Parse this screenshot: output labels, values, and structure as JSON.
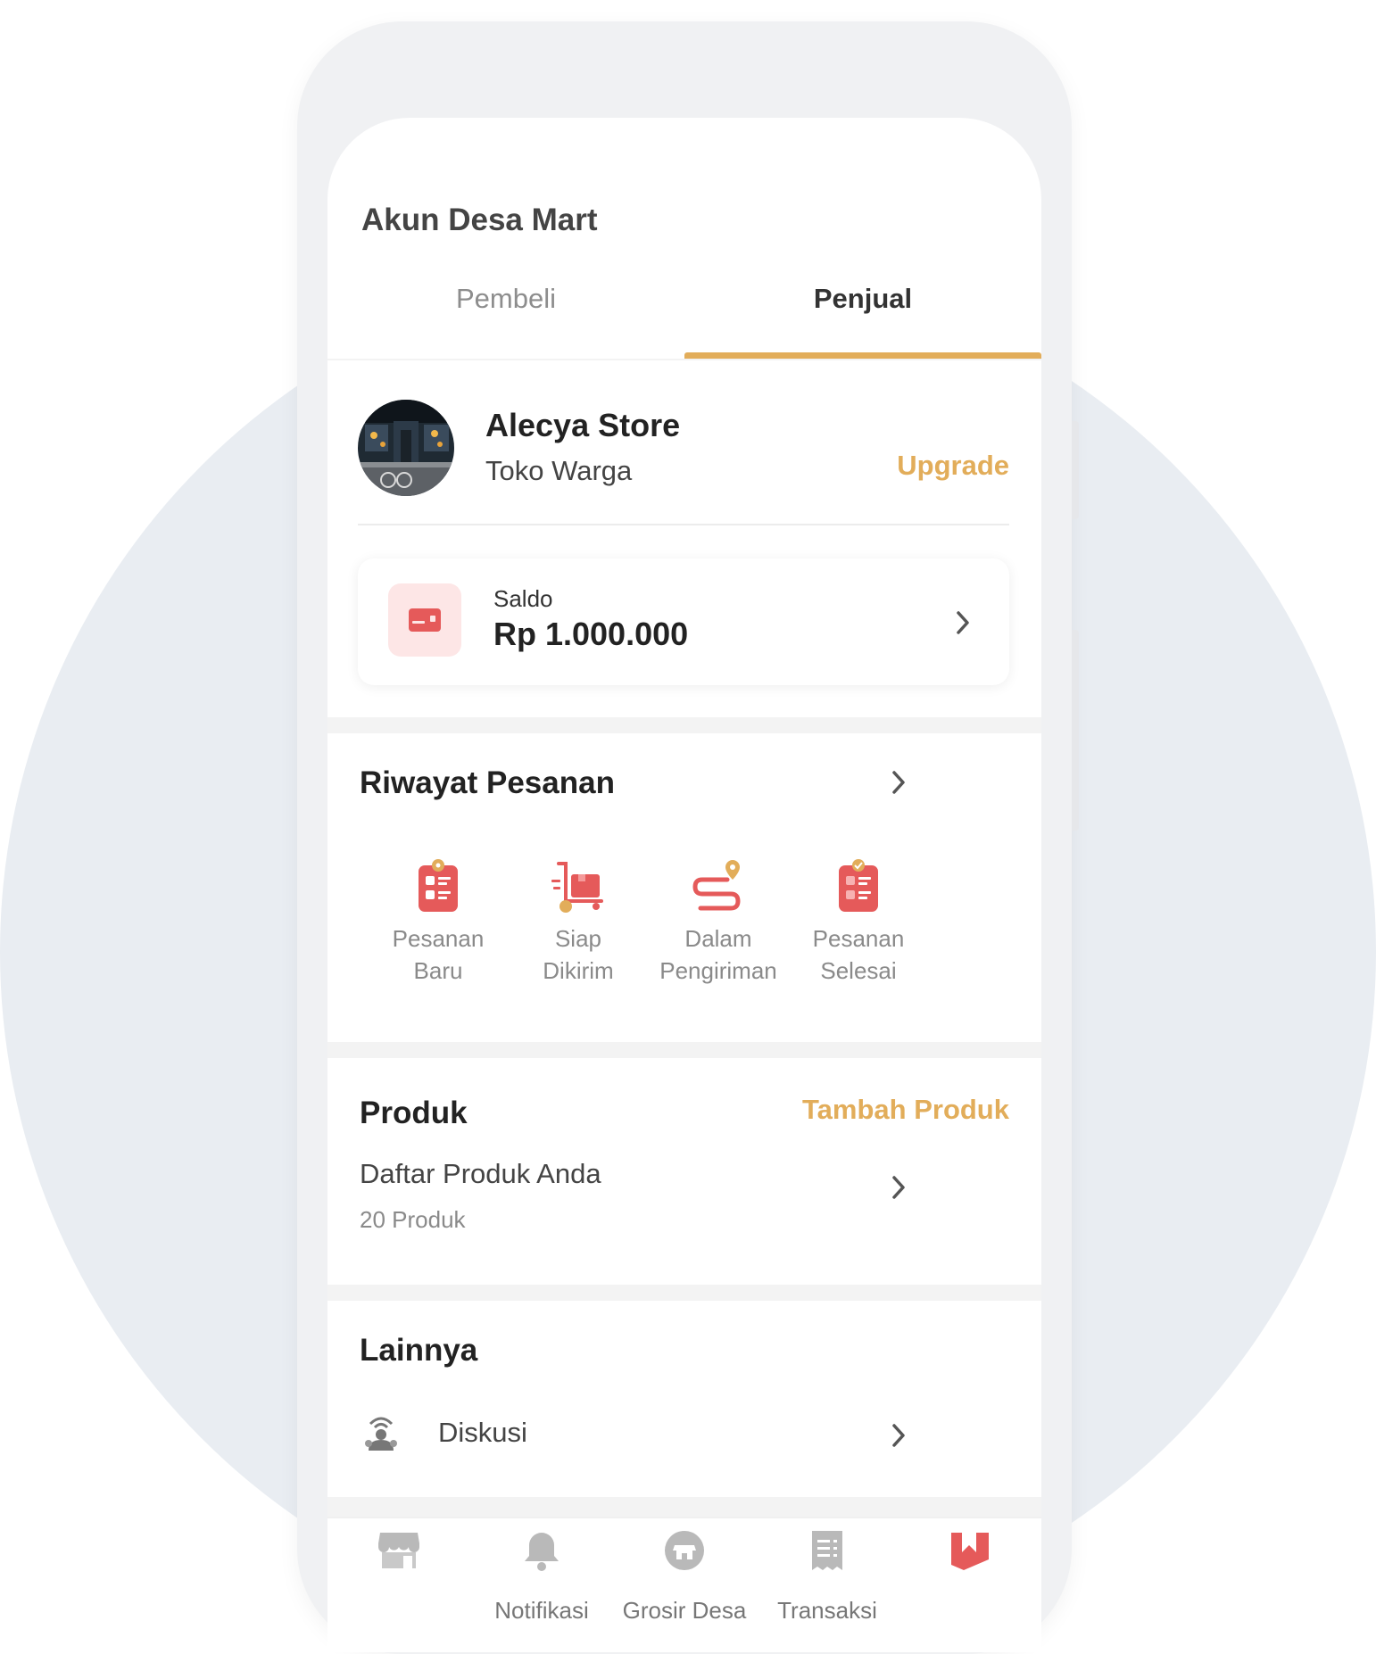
{
  "app": {
    "title": "Akun Desa Mart"
  },
  "tabs": [
    {
      "label": "Pembeli",
      "active": false
    },
    {
      "label": "Penjual",
      "active": true
    }
  ],
  "store": {
    "name": "Alecya Store",
    "type": "Toko Warga",
    "upgrade_label": "Upgrade"
  },
  "saldo": {
    "label": "Saldo",
    "value": "Rp 1.000.000",
    "icon": "wallet-icon"
  },
  "orders": {
    "title": "Riwayat Pesanan",
    "items": [
      {
        "line1": "Pesanan",
        "line2": "Baru",
        "icon": "new-order-icon"
      },
      {
        "line1": "Siap",
        "line2": "Dikirim",
        "icon": "ready-to-ship-icon"
      },
      {
        "line1": "Dalam",
        "line2": "Pengiriman",
        "icon": "in-delivery-icon"
      },
      {
        "line1": "Pesanan",
        "line2": "Selesai",
        "icon": "order-complete-icon"
      }
    ]
  },
  "products": {
    "title": "Produk",
    "add_label": "Tambah Produk",
    "list_label": "Daftar Produk Anda",
    "count": "20 Produk"
  },
  "other": {
    "title": "Lainnya",
    "items": [
      {
        "label": "Diskusi",
        "icon": "discussion-icon"
      }
    ]
  },
  "bottom_nav": [
    {
      "label": "",
      "icon": "store-icon",
      "active": false
    },
    {
      "label": "Notifikasi",
      "icon": "bell-icon",
      "active": false
    },
    {
      "label": "Grosir Desa",
      "icon": "shop-icon",
      "active": false
    },
    {
      "label": "Transaksi",
      "icon": "receipt-icon",
      "active": false
    },
    {
      "label": "",
      "icon": "bookmark-icon",
      "active": true
    }
  ],
  "colors": {
    "accent": "#e2ad5a",
    "primary_red": "#e55a5a",
    "background_circle": "#e9edf2"
  }
}
